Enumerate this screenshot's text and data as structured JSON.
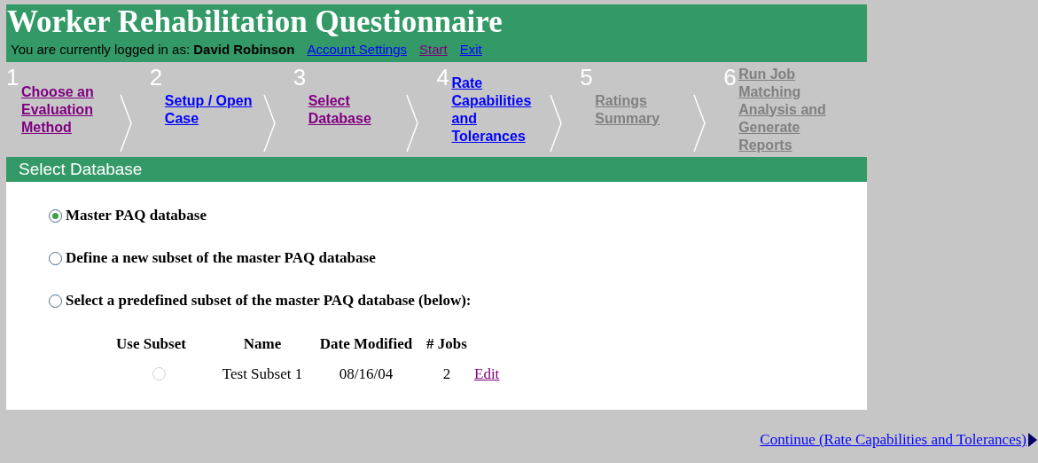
{
  "header": {
    "title": "Worker Rehabilitation Questionnaire",
    "login_prefix": "You are currently logged in as:",
    "user": "David Robinson",
    "links": [
      {
        "label": "Account Settings",
        "visited": false
      },
      {
        "label": "Start",
        "visited": true
      },
      {
        "label": "Exit",
        "visited": false
      }
    ]
  },
  "steps": [
    {
      "number": "1",
      "label": "Choose an Evaluation Method",
      "visited": true,
      "disabled": false
    },
    {
      "number": "2",
      "label": "Setup / Open Case",
      "visited": false,
      "disabled": false
    },
    {
      "number": "3",
      "label": "Select Database",
      "visited": true,
      "disabled": false
    },
    {
      "number": "4",
      "label": "Rate Capabilities and Tolerances",
      "visited": false,
      "disabled": false
    },
    {
      "number": "5",
      "label": "Ratings Summary",
      "disabled": true
    },
    {
      "number": "6",
      "label": "Run Job Matching Analysis and Generate Reports",
      "disabled": true
    }
  ],
  "section_title": "Select Database",
  "options": [
    {
      "label": "Master PAQ database",
      "selected": true
    },
    {
      "label": "Define a new subset of the master PAQ database",
      "selected": false
    },
    {
      "label": "Select a predefined subset of the master PAQ database (below):",
      "selected": false
    }
  ],
  "subset_table": {
    "columns": [
      "Use Subset",
      "Name",
      "Date Modified",
      "# Jobs"
    ],
    "rows": [
      {
        "selected": false,
        "disabled": true,
        "name": "Test Subset 1",
        "date_modified": "08/16/04",
        "jobs": "2",
        "action": "Edit"
      }
    ]
  },
  "continue_link": "Continue (Rate Capabilities and Tolerances)"
}
